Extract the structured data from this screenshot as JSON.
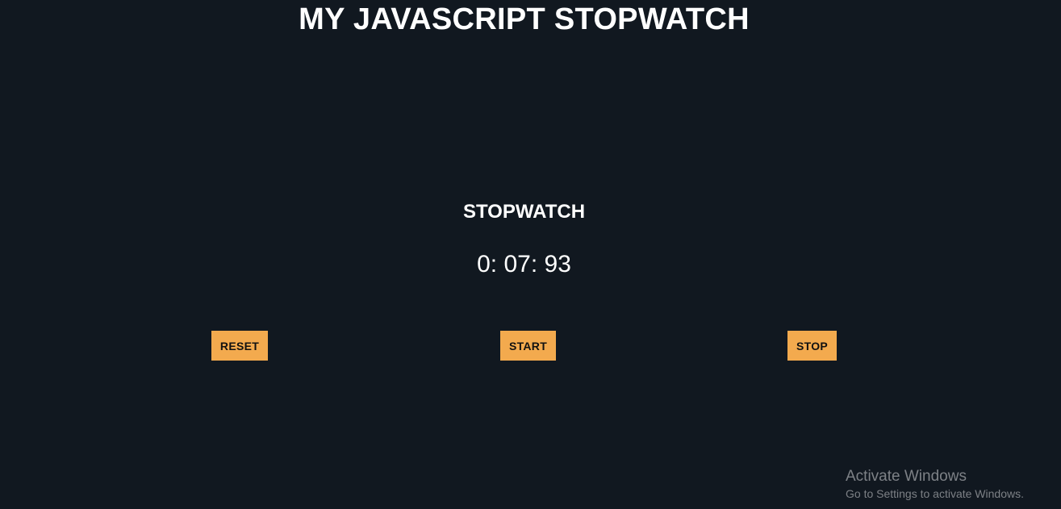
{
  "header": {
    "title": "MY JAVASCRIPT STOPWATCH"
  },
  "stopwatch": {
    "heading": "STOPWATCH",
    "time": "0: 07: 93"
  },
  "controls": {
    "reset_label": "RESET",
    "start_label": "START",
    "stop_label": "STOP"
  },
  "watermark": {
    "title": "Activate Windows",
    "subtitle": "Go to Settings to activate Windows."
  },
  "colors": {
    "background": "#111820",
    "button": "#f3aa4e",
    "text": "#ffffff"
  }
}
